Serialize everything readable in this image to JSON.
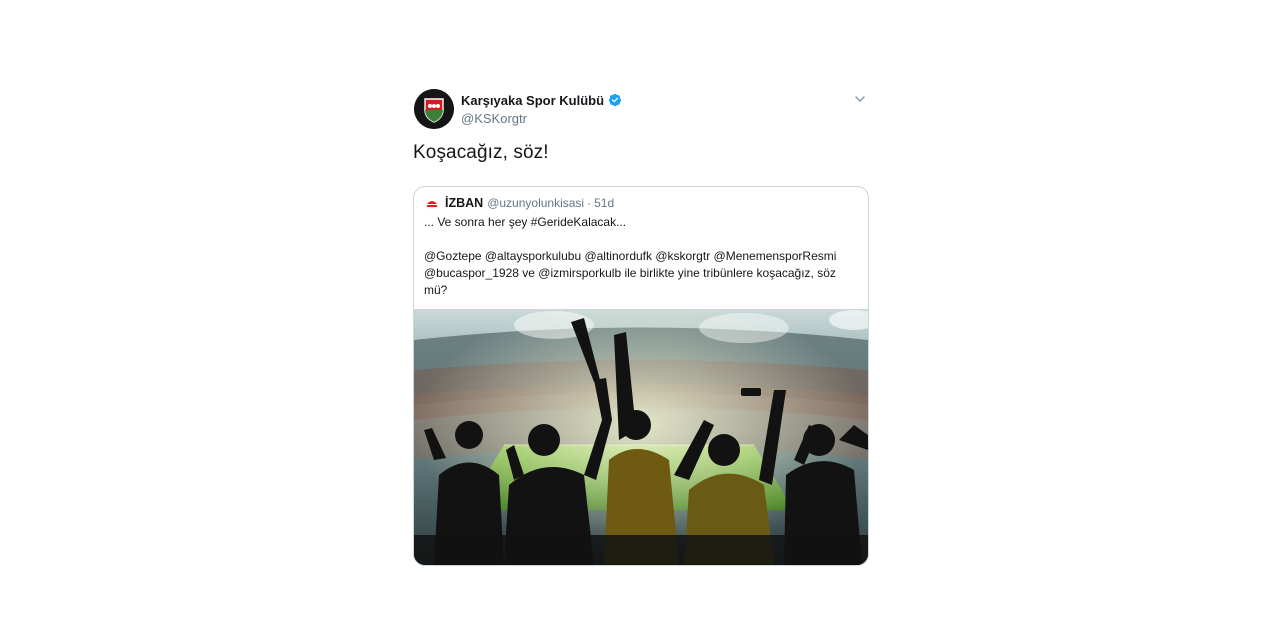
{
  "tweet": {
    "display_name": "Karşıyaka Spor Kulübü",
    "handle": "@KSKorgtr",
    "text": "Koşacağız, söz!",
    "avatar_icon": "karsiyaka-crest-icon",
    "verified_icon": "verified-badge-icon",
    "menu_icon": "chevron-down-icon"
  },
  "quote": {
    "display_name": "İZBAN",
    "handle": "@uzunyolunkisasi",
    "separator": "·",
    "time": "51d",
    "line1": "... Ve sonra her şey #GerideKalacak...",
    "line2": "@Goztepe @altaysporkulubu @altinordufk @kskorgtr @MenemensporResmi",
    "line3": "@bucaspor_1928 ve @izmirsporkulb ile birlikte yine tribünlere koşacağız, söz mü?",
    "image_desc_icon": "stadium-fans-image"
  },
  "colors": {
    "verified": "#1da1f2",
    "secondary_text": "#657786",
    "border": "#ccd6dd",
    "brand_red": "#e2231a"
  }
}
